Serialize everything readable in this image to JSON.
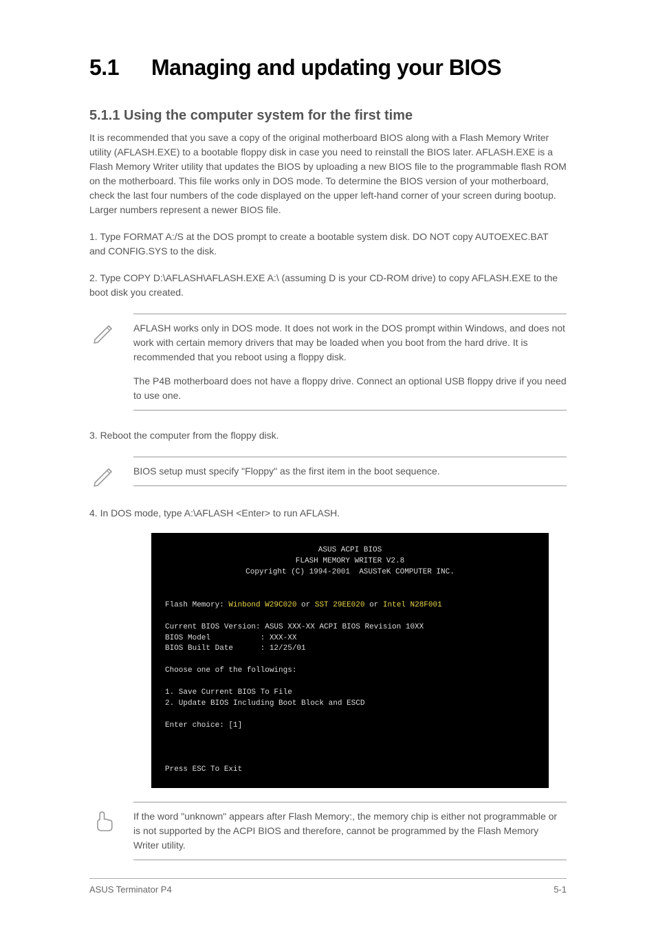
{
  "heading_num": "5.1",
  "heading_title": "Managing and updating your BIOS",
  "sub1_title": "5.1.1 Using the computer system for the first time",
  "p1": "It is recommended that you save a copy of the original motherboard BIOS along with a Flash Memory Writer utility (AFLASH.EXE) to a bootable floppy disk in case you need to reinstall the BIOS later. AFLASH.EXE is a Flash Memory Writer utility that updates the BIOS by uploading a new BIOS file to the programmable flash ROM on the motherboard. This file works only in DOS mode. To determine the BIOS version of your motherboard, check the last four numbers of the code displayed on the upper left-hand corner of your screen during bootup. Larger numbers represent a newer BIOS file.",
  "bold_aflash": "AFLASH.EXE",
  "s1": "1.  Type FORMAT A:/S at the DOS prompt to create a bootable system disk. DO NOT copy AUTOEXEC.BAT and CONFIG.SYS to the disk.",
  "s2": "2.  Type COPY D:\\AFLASH\\AFLASH.EXE A:\\ (assuming D is your CD-ROM drive) to copy AFLASH.EXE to the boot disk you created.",
  "note1a": "AFLASH works only in DOS mode. It does not work in the DOS prompt within Windows, and does not work with certain memory drivers that may be loaded when you boot from the hard drive. It is recommended that you reboot using a floppy disk.",
  "note1b": "The P4B motherboard does not have a floppy drive. Connect an optional USB floppy drive if you need to use one.",
  "s3": "3.  Reboot the computer from the floppy disk.",
  "note2": "BIOS setup must specify \"Floppy\" as the first item in the boot sequence.",
  "s4": "4.  In DOS mode, type A:\\AFLASH <Enter> to run AFLASH.",
  "term_h1": "ASUS ACPI BIOS",
  "term_h2": "FLASH MEMORY WRITER V2.8",
  "term_h3": "Copyright (C) 1994-2001  ASUSTeK COMPUTER INC.",
  "term_fm_label": "Flash Memory: ",
  "term_fm_y1": "Winbond W29C020",
  "term_fm_or1": " or ",
  "term_fm_y2": "SST 29EE020",
  "term_fm_or2": " or ",
  "term_fm_y3": "Intel N28F001",
  "term_l1": "Current BIOS Version: ASUS XXX-XX ACPI BIOS Revision 10XX",
  "term_l2": "BIOS Model           : XXX-XX",
  "term_l3": "BIOS Built Date      : 12/25/01",
  "term_l4": "Choose one of the followings:",
  "term_l5": "1. Save Current BIOS To File",
  "term_l6": "2. Update BIOS Including Boot Block and ESCD",
  "term_l7": "Enter choice: [1]",
  "term_l8": "Press ESC To Exit",
  "note3": "If the word \"unknown\" appears after Flash Memory:, the memory chip is either not programmable or is not supported by the ACPI BIOS and therefore, cannot be programmed by the Flash Memory Writer utility.",
  "footer_left": "ASUS Terminator P4",
  "footer_right": "5-1"
}
